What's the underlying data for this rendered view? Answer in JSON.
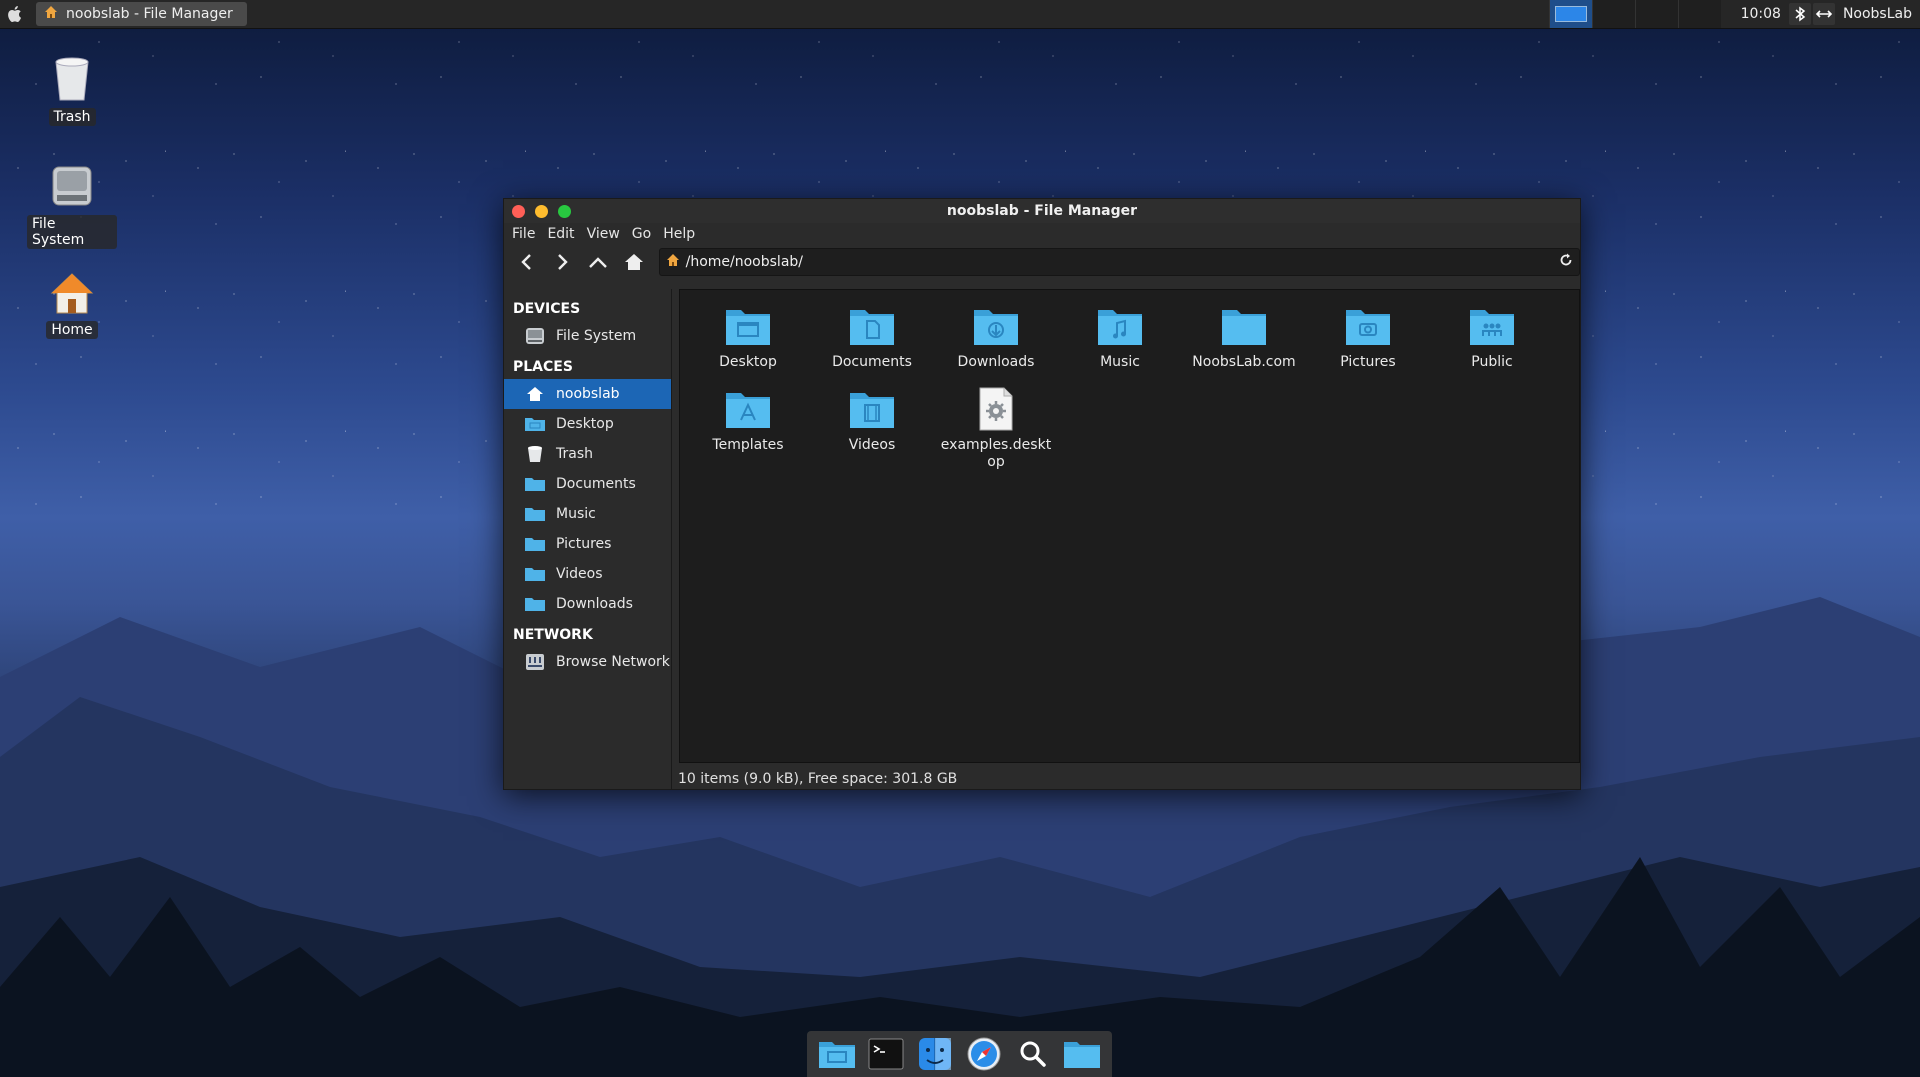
{
  "top_panel": {
    "app_menu_icon": "apple-icon",
    "task_title": "noobslab - File Manager",
    "clock": "10:08",
    "user": "NoobsLab"
  },
  "desktop_icons": [
    {
      "label": "Trash",
      "icon": "trash-icon"
    },
    {
      "label": "File System",
      "icon": "drive-icon"
    },
    {
      "label": "Home",
      "icon": "home-icon"
    }
  ],
  "window": {
    "title": "noobslab - File Manager",
    "menu": [
      "File",
      "Edit",
      "View",
      "Go",
      "Help"
    ],
    "path": "/home/noobslab/",
    "sidebar": {
      "devices_heading": "DEVICES",
      "devices": [
        {
          "label": "File System",
          "icon": "drive-icon"
        }
      ],
      "places_heading": "PLACES",
      "places": [
        {
          "label": "noobslab",
          "icon": "home-icon",
          "active": true
        },
        {
          "label": "Desktop",
          "icon": "folder-desktop-icon"
        },
        {
          "label": "Trash",
          "icon": "trash-icon"
        },
        {
          "label": "Documents",
          "icon": "folder-documents-icon"
        },
        {
          "label": "Music",
          "icon": "folder-music-icon"
        },
        {
          "label": "Pictures",
          "icon": "folder-pictures-icon"
        },
        {
          "label": "Videos",
          "icon": "folder-videos-icon"
        },
        {
          "label": "Downloads",
          "icon": "folder-downloads-icon"
        }
      ],
      "network_heading": "NETWORK",
      "network": [
        {
          "label": "Browse Network",
          "icon": "network-icon"
        }
      ]
    },
    "files": [
      {
        "name": "Desktop",
        "icon": "folder-desktop-icon"
      },
      {
        "name": "Documents",
        "icon": "folder-documents-icon"
      },
      {
        "name": "Downloads",
        "icon": "folder-downloads-icon"
      },
      {
        "name": "Music",
        "icon": "folder-music-icon"
      },
      {
        "name": "NoobsLab.com",
        "icon": "folder-icon"
      },
      {
        "name": "Pictures",
        "icon": "folder-pictures-icon"
      },
      {
        "name": "Public",
        "icon": "folder-public-icon"
      },
      {
        "name": "Templates",
        "icon": "folder-templates-icon"
      },
      {
        "name": "Videos",
        "icon": "folder-videos-icon"
      },
      {
        "name": "examples.desktop",
        "icon": "desktop-file-icon"
      }
    ],
    "status": "10 items (9.0 kB), Free space: 301.8 GB"
  },
  "dock": [
    {
      "name": "file-manager",
      "icon": "folder-icon"
    },
    {
      "name": "terminal",
      "icon": "terminal-icon"
    },
    {
      "name": "finder",
      "icon": "finder-icon"
    },
    {
      "name": "safari",
      "icon": "compass-icon"
    },
    {
      "name": "search",
      "icon": "search-icon"
    },
    {
      "name": "folder",
      "icon": "folder-icon"
    }
  ],
  "colors": {
    "accent": "#1c66b5",
    "folder": "#4fb3e8",
    "window_bg": "#2b2b2b",
    "content_bg": "#1d1d1d"
  }
}
